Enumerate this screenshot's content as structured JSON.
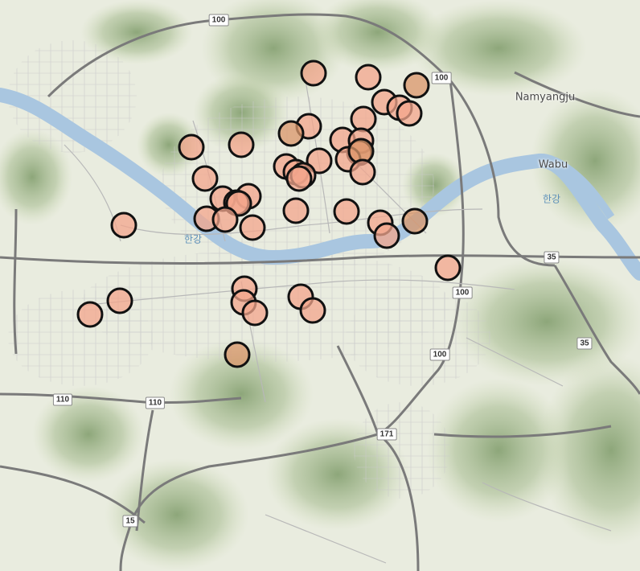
{
  "map": {
    "place_labels": [
      {
        "id": "namyangju",
        "text": "Namyangju"
      },
      {
        "id": "wabu",
        "text": "Wabu"
      }
    ],
    "river_labels": [
      {
        "id": "hangang-west",
        "text": "한강"
      },
      {
        "id": "hangang-east",
        "text": "한강"
      }
    ],
    "road_shields": [
      {
        "id": "r100-top",
        "text": "100"
      },
      {
        "id": "r100-ne",
        "text": "100"
      },
      {
        "id": "r100-e",
        "text": "100"
      },
      {
        "id": "r100-se",
        "text": "100"
      },
      {
        "id": "r35-a",
        "text": "35"
      },
      {
        "id": "r35-b",
        "text": "35"
      },
      {
        "id": "r110-a",
        "text": "110"
      },
      {
        "id": "r110-b",
        "text": "110"
      },
      {
        "id": "r171",
        "text": "171"
      },
      {
        "id": "r15",
        "text": "15"
      }
    ],
    "colors": {
      "marker_fill": "#f3a58c",
      "marker_fill_dark": "#d9956a",
      "marker_stroke": "#111111",
      "river": "#a9c6e0",
      "land": "#e9ecdf",
      "vegetation": "#c9d7b0",
      "mountain": "#8fa97a",
      "road_major": "#7a7a7a",
      "road_minor": "#b8b8b8"
    },
    "marker_count": 48
  }
}
